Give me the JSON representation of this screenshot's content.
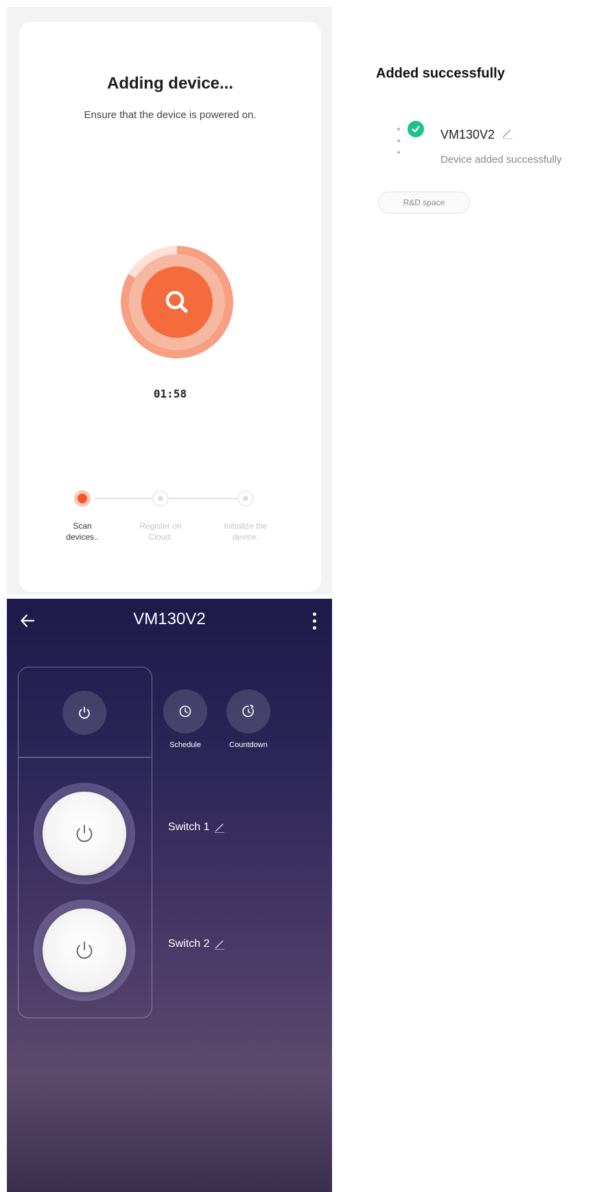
{
  "adding": {
    "title": "Adding device...",
    "subtitle": "Ensure that the device is powered on.",
    "timer": "01:58",
    "steps": [
      {
        "label_line1": "Scan",
        "label_line2": "devices..",
        "state": "active"
      },
      {
        "label_line1": "Register on",
        "label_line2": "Cloud.",
        "state": "pending"
      },
      {
        "label_line1": "Initialize the",
        "label_line2": "device.",
        "state": "pending"
      }
    ],
    "icons": {
      "radar": "search-icon"
    },
    "colors": {
      "accent": "#f56b3e",
      "ring": "#f7b8a2"
    }
  },
  "success": {
    "title": "Added successfully",
    "device_name": "VM130V2",
    "status": "Device added successfully",
    "room": "R&D space",
    "icons": {
      "check": "check-circle-icon",
      "edit": "pencil-icon"
    },
    "colors": {
      "check": "#1ec18a"
    }
  },
  "control": {
    "title": "VM130V2",
    "schedule_label": "Schedule",
    "countdown_label": "Countdown",
    "switches": [
      {
        "label": "Switch 1"
      },
      {
        "label": "Switch 2"
      }
    ],
    "icons": {
      "back": "arrow-left-icon",
      "more": "more-vertical-icon",
      "master": "power-icon",
      "schedule": "clock-icon",
      "countdown": "countdown-icon"
    }
  }
}
